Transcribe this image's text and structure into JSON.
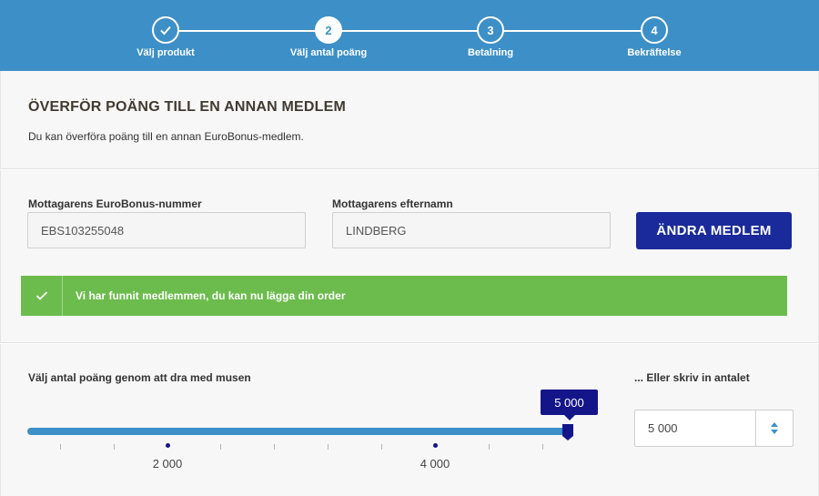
{
  "stepper": {
    "steps": [
      {
        "number": "",
        "label": "Välj produkt",
        "state": "done"
      },
      {
        "number": "2",
        "label": "Välj antal poäng",
        "state": "active"
      },
      {
        "number": "3",
        "label": "Betalning",
        "state": "upcoming"
      },
      {
        "number": "4",
        "label": "Bekräftelse",
        "state": "upcoming"
      }
    ]
  },
  "intro": {
    "title": "ÖVERFÖR POÄNG TILL EN ANNAN MEDLEM",
    "subtitle": "Du kan överföra poäng till en annan EuroBonus-medlem."
  },
  "member": {
    "number_label": "Mottagarens EuroBonus-nummer",
    "number_value": "EBS103255048",
    "lastname_label": "Mottagarens efternamn",
    "lastname_value": "LINDBERG",
    "change_button": "ÄNDRA MEDLEM",
    "success_message": "Vi har funnit medlemmen, du kan nu lägga din order"
  },
  "points": {
    "slider_label": "Välj antal poäng genom att dra med musen",
    "input_label": "... Eller skriv in antalet",
    "value_display": "5 000",
    "input_value": "5 000",
    "slider_value": 5000,
    "slider_min": 0,
    "slider_max": 5000,
    "tick_labels": [
      "2 000",
      "4 000"
    ]
  },
  "colors": {
    "header_blue": "#3d90c7",
    "navy": "#15158a",
    "button_navy": "#1a2a9a",
    "success_green": "#6cbc4d"
  }
}
